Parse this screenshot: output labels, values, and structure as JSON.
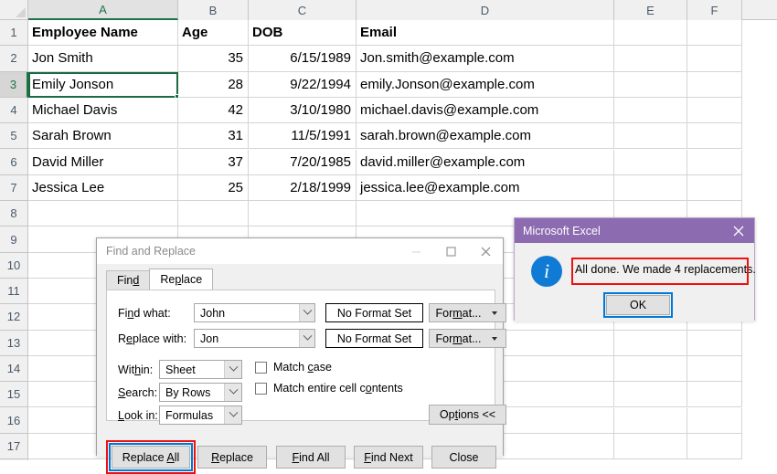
{
  "spreadsheet": {
    "columns": [
      {
        "label": "A",
        "selected": true
      },
      {
        "label": "B",
        "selected": false
      },
      {
        "label": "C",
        "selected": false
      },
      {
        "label": "D",
        "selected": false
      },
      {
        "label": "E",
        "selected": false
      },
      {
        "label": "F",
        "selected": false
      }
    ],
    "row_labels": [
      "1",
      "2",
      "3",
      "4",
      "5",
      "6",
      "7",
      "8",
      "9",
      "10",
      "11",
      "12",
      "13",
      "14",
      "15",
      "16",
      "17"
    ],
    "active_cell": "A3",
    "selected_row": "3",
    "headers": [
      "Employee Name",
      "Age",
      "DOB",
      "Email"
    ],
    "rows": [
      {
        "name": "Jon Smith",
        "age": "35",
        "dob": "6/15/1989",
        "email": "Jon.smith@example.com"
      },
      {
        "name": "Emily Jonson",
        "age": "28",
        "dob": "9/22/1994",
        "email": "emily.Jonson@example.com"
      },
      {
        "name": "Michael Davis",
        "age": "42",
        "dob": "3/10/1980",
        "email": "michael.davis@example.com"
      },
      {
        "name": "Sarah Brown",
        "age": "31",
        "dob": "11/5/1991",
        "email": "sarah.brown@example.com"
      },
      {
        "name": "David Miller",
        "age": "37",
        "dob": "7/20/1985",
        "email": "david.miller@example.com"
      },
      {
        "name": "Jessica Lee",
        "age": "25",
        "dob": "2/18/1999",
        "email": "jessica.lee@example.com"
      }
    ]
  },
  "find_replace_dialog": {
    "title": "Find and Replace",
    "window_controls": {
      "minimize": "minimize-icon",
      "maximize": "maximize-icon",
      "close": "close-icon"
    },
    "tabs": [
      {
        "label": "Find",
        "active": false
      },
      {
        "label": "Replace",
        "active": true
      }
    ],
    "fields": {
      "find_what_label": "Find what:",
      "find_what_value": "John",
      "replace_with_label": "Replace with:",
      "replace_with_value": "Jon",
      "find_format_status": "No Format Set",
      "replace_format_status": "No Format Set",
      "find_format_button": "Format...",
      "replace_format_button": "Format..."
    },
    "options": {
      "within_label": "Within:",
      "within_value": "Sheet",
      "search_label": "Search:",
      "search_value": "By Rows",
      "look_in_label": "Look in:",
      "look_in_value": "Formulas",
      "match_case_label": "Match case",
      "match_case_checked": false,
      "match_entire_label": "Match entire cell contents",
      "match_entire_checked": false,
      "options_button": "Options <<"
    },
    "buttons": [
      {
        "label": "Replace All",
        "focused": true,
        "highlighted": true
      },
      {
        "label": "Replace",
        "focused": false,
        "highlighted": false
      },
      {
        "label": "Find All",
        "focused": false,
        "highlighted": false
      },
      {
        "label": "Find Next",
        "focused": false,
        "highlighted": false
      },
      {
        "label": "Close",
        "focused": false,
        "highlighted": false
      }
    ]
  },
  "message_box": {
    "title": "Microsoft Excel",
    "close_icon": "close-icon",
    "icon": "information-icon",
    "icon_glyph": "i",
    "message": "All done. We made 4 replacements.",
    "message_highlighted": true,
    "ok_button": "OK",
    "ok_focused": true
  },
  "colors": {
    "excel_green": "#217346",
    "msgbox_purple": "#8c6bb1",
    "focus_blue": "#0078d7",
    "annotation_red": "#ee1111",
    "info_blue": "#0f7bd4"
  }
}
